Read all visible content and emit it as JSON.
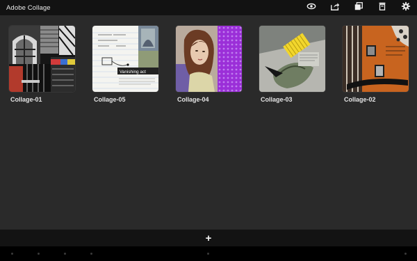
{
  "app": {
    "title": "Adobe Collage"
  },
  "toolbar": {
    "icons": [
      "view-icon",
      "share-icon",
      "duplicate-icon",
      "delete-icon",
      "settings-icon"
    ]
  },
  "collages": [
    {
      "name": "Collage-01"
    },
    {
      "name": "Collage-05",
      "caption": "Vanishing act"
    },
    {
      "name": "Collage-04"
    },
    {
      "name": "Collage-03"
    },
    {
      "name": "Collage-02"
    }
  ],
  "bottom": {
    "add_label": "+"
  },
  "colors": {
    "top_bar": "#121212",
    "background": "#2a2a2a",
    "bottom_bar": "#131313",
    "accent_purple": "#9b2fd8",
    "accent_orange": "#c8641f",
    "accent_yellow": "#e8d52a"
  }
}
